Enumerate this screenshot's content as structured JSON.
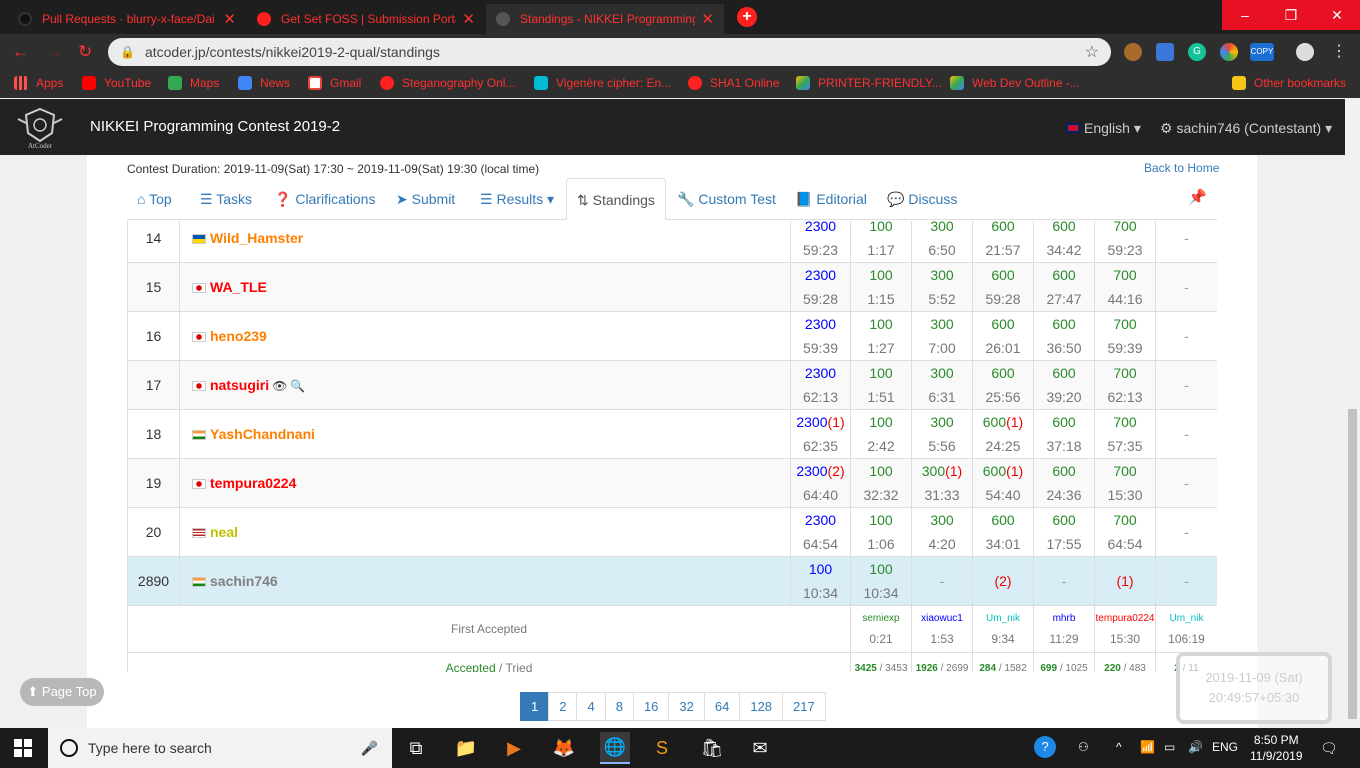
{
  "browser": {
    "tabs": [
      {
        "title": "Pull Requests · blurry-x-face/Dai",
        "favicon": "github-icon"
      },
      {
        "title": "Get Set FOSS | Submission Portal",
        "favicon": "globe-icon"
      },
      {
        "title": "Standings - NIKKEI Programming",
        "favicon": "atcoder-icon"
      }
    ],
    "new_tab": "+",
    "window_buttons": [
      "–",
      "❐",
      "✕"
    ],
    "url": "atcoder.jp/contests/nikkei2019-2-qual/standings",
    "bookmarks": [
      "Apps",
      "YouTube",
      "Maps",
      "News",
      "Gmail",
      "Steganography Onl...",
      "Vigenère cipher: En...",
      "SHA1 Online",
      "PRINTER-FRIENDLY...",
      "Web Dev Outline -...",
      "Other bookmarks"
    ]
  },
  "header": {
    "contest_title": "NIKKEI Programming Contest 2019-2",
    "language": "English",
    "user": "sachin746 (Contestant)"
  },
  "duration": "Contest Duration: 2019-11-09(Sat) 17:30 ~ 2019-11-09(Sat) 19:30 (local time)",
  "back_home": "Back to Home",
  "nav": [
    "Top",
    "Tasks",
    "Clarifications",
    "Submit",
    "Results",
    "Standings",
    "Custom Test",
    "Editorial",
    "Discuss"
  ],
  "rows": [
    {
      "rank": "14",
      "user": "Wild_Hamster",
      "color": "#ff8000",
      "flag": "ua",
      "total": "2300",
      "total_pen": "",
      "total_time": "59:23",
      "A": [
        "100",
        "",
        "1:17"
      ],
      "B": [
        "300",
        "",
        "6:50"
      ],
      "C": [
        "600",
        "",
        "21:57"
      ],
      "D": [
        "600",
        "",
        "34:42"
      ],
      "E": [
        "700",
        "",
        "59:23"
      ],
      "F": "-"
    },
    {
      "rank": "15",
      "user": "WA_TLE",
      "color": "#ff0000",
      "flag": "jp",
      "total": "2300",
      "total_pen": "",
      "total_time": "59:28",
      "A": [
        "100",
        "",
        "1:15"
      ],
      "B": [
        "300",
        "",
        "5:52"
      ],
      "C": [
        "600",
        "",
        "59:28"
      ],
      "D": [
        "600",
        "",
        "27:47"
      ],
      "E": [
        "700",
        "",
        "44:16"
      ],
      "F": "-"
    },
    {
      "rank": "16",
      "user": "heno239",
      "color": "#ff8000",
      "flag": "jp",
      "total": "2300",
      "total_pen": "",
      "total_time": "59:39",
      "A": [
        "100",
        "",
        "1:27"
      ],
      "B": [
        "300",
        "",
        "7:00"
      ],
      "C": [
        "600",
        "",
        "26:01"
      ],
      "D": [
        "600",
        "",
        "36:50"
      ],
      "E": [
        "700",
        "",
        "59:39"
      ],
      "F": "-"
    },
    {
      "rank": "17",
      "user": "natsugiri",
      "color": "#ff0000",
      "flag": "jp",
      "total": "2300",
      "total_pen": "",
      "total_time": "62:13",
      "A": [
        "100",
        "",
        "1:51"
      ],
      "B": [
        "300",
        "",
        "6:31"
      ],
      "C": [
        "600",
        "",
        "25:56"
      ],
      "D": [
        "600",
        "",
        "39:20"
      ],
      "E": [
        "700",
        "",
        "62:13"
      ],
      "F": "-"
    },
    {
      "rank": "18",
      "user": "YashChandnani",
      "color": "#ff8000",
      "flag": "in",
      "total": "2300",
      "total_pen": "(1)",
      "total_time": "62:35",
      "A": [
        "100",
        "",
        "2:42"
      ],
      "B": [
        "300",
        "",
        "5:56"
      ],
      "C": [
        "600",
        "(1)",
        "24:25"
      ],
      "D": [
        "600",
        "",
        "37:18"
      ],
      "E": [
        "700",
        "",
        "57:35"
      ],
      "F": "-"
    },
    {
      "rank": "19",
      "user": "tempura0224",
      "color": "#ff0000",
      "flag": "jp",
      "total": "2300",
      "total_pen": "(2)",
      "total_time": "64:40",
      "A": [
        "100",
        "",
        "32:32"
      ],
      "B": [
        "300",
        "(1)",
        "31:33"
      ],
      "C": [
        "600",
        "(1)",
        "54:40"
      ],
      "D": [
        "600",
        "",
        "24:36"
      ],
      "E": [
        "700",
        "",
        "15:30"
      ],
      "F": "-"
    },
    {
      "rank": "20",
      "user": "neal",
      "color": "#c0c000",
      "flag": "us",
      "total": "2300",
      "total_pen": "",
      "total_time": "64:54",
      "A": [
        "100",
        "",
        "1:06"
      ],
      "B": [
        "300",
        "",
        "4:20"
      ],
      "C": [
        "600",
        "",
        "34:01"
      ],
      "D": [
        "600",
        "",
        "17:55"
      ],
      "E": [
        "700",
        "",
        "64:54"
      ],
      "F": "-"
    },
    {
      "rank": "2890",
      "user": "sachin746",
      "color": "#808080",
      "flag": "in",
      "total": "100",
      "total_pen": "",
      "total_time": "10:34",
      "A": [
        "100",
        "",
        "10:34"
      ],
      "B": "-",
      "C": "(2)",
      "D": "-",
      "E": "(1)",
      "F": "-"
    }
  ],
  "first_accepted": {
    "label": "First Accepted",
    "cells": [
      {
        "user": "semiexp",
        "color": "#2a8a2a",
        "time": "0:21"
      },
      {
        "user": "xiaowuc1",
        "color": "#0000ff",
        "time": "1:53"
      },
      {
        "user": "Um_nik",
        "color": "#00c0c0",
        "time": "9:34"
      },
      {
        "user": "mhrb",
        "color": "#0000ff",
        "time": "11:29"
      },
      {
        "user": "tempura0224",
        "color": "#ff0000",
        "time": "15:30"
      },
      {
        "user": "Um_nik",
        "color": "#00c0c0",
        "time": "106:19"
      }
    ]
  },
  "accepted_tried": {
    "label_a": "Accepted",
    "sep": "/",
    "label_t": "Tried",
    "cells": [
      [
        "3425",
        "3453"
      ],
      [
        "1926",
        "2699"
      ],
      [
        "284",
        "1582"
      ],
      [
        "699",
        "1025"
      ],
      [
        "220",
        "483"
      ],
      [
        "2",
        "11"
      ]
    ]
  },
  "pages": [
    "1",
    "2",
    "4",
    "8",
    "16",
    "32",
    "64",
    "128",
    "217"
  ],
  "page_top": "Page Top",
  "clock": {
    "date": "2019-11-09 (Sat)",
    "time": "20:49:57+05:30"
  },
  "taskbar": {
    "search": "Type here to search",
    "lang": "ENG",
    "time": "8:50 PM",
    "date": "11/9/2019"
  }
}
